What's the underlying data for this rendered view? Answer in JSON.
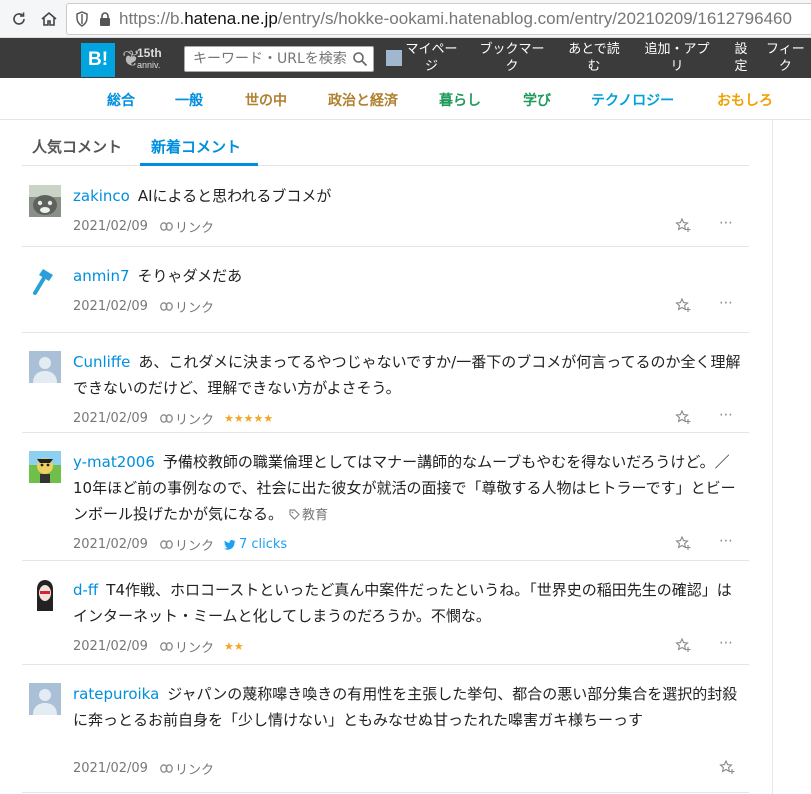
{
  "browser": {
    "url_prefix": "https://b.",
    "url_host": "hatena.ne.jp",
    "url_rest": "/entry/s/hokke-ookami.hatenablog.com/entry/20210209/1612796460"
  },
  "header": {
    "logo": "B!",
    "anniv_number": "15th",
    "anniv_text": "anniv.",
    "search_placeholder": "キーワード・URLを検索",
    "menu": {
      "mypage": "マイペー\nジ",
      "bookmark": "ブックマー\nク",
      "later": "あとで読\nむ",
      "add_app": "追加・アプ\nリ",
      "settings": "設\n定",
      "feed": "フィー\nク"
    },
    "logo_color": "#00a4de",
    "bar_color": "#3b3b3b"
  },
  "categories": [
    {
      "label": "総合",
      "color": "#008fde"
    },
    {
      "label": "一般",
      "color": "#008fde"
    },
    {
      "label": "世の中",
      "color": "#b0802f"
    },
    {
      "label": "政治と経済",
      "color": "#b0802f"
    },
    {
      "label": "暮らし",
      "color": "#1f9a5a"
    },
    {
      "label": "学び",
      "color": "#1f9a5a"
    },
    {
      "label": "テクノロジー",
      "color": "#00a0d8"
    },
    {
      "label": "おもしろ",
      "color": "#f0a000"
    }
  ],
  "tabs": {
    "popular": "人気コメント",
    "newest": "新着コメント"
  },
  "comments": [
    {
      "user": "zakinco",
      "text": "AIによると思われるブコメが",
      "date": "2021/02/09",
      "link": "リンク"
    },
    {
      "user": "anmin7",
      "text": "そりゃダメだあ",
      "date": "2021/02/09",
      "link": "リンク"
    },
    {
      "user": "Cunliffe",
      "text": "あ、これダメに決まってるやつじゃないですか/一番下のブコメが何言ってるのか全く理解できないのだけど、理解できない方がよさそう。",
      "date": "2021/02/09",
      "link": "リンク",
      "stars": "★★★★★"
    },
    {
      "user": "y-mat2006",
      "text": "予備校教師の職業倫理としてはマナー講師的なムーブもやむを得ないだろうけど。／10年ほど前の事例なので、社会に出た彼女が就活の面接で「尊敬する人物はヒトラーです」とビーンボール投げたかが気になる。",
      "tag": "教育",
      "date": "2021/02/09",
      "link": "リンク",
      "twitter": "7 clicks"
    },
    {
      "user": "d-ff",
      "text": "T4作戦、ホロコーストといったど真ん中案件だったというね。「世界史の稲田先生の確認」はインターネット・ミームと化してしまうのだろうか。不憫な。",
      "date": "2021/02/09",
      "link": "リンク",
      "stars": "★★"
    },
    {
      "user": "ratepuroika",
      "text": "ジャパンの蔑称嗥き喚きの有用性を主張した挙句、都合の悪い部分集合を選択的封殺に奔っとるお前自身を「少し情けない」ともみなせぬ甘ったれた嗥害ガキ様ちーっす",
      "date": "2021/02/09",
      "link": "リンク"
    }
  ]
}
